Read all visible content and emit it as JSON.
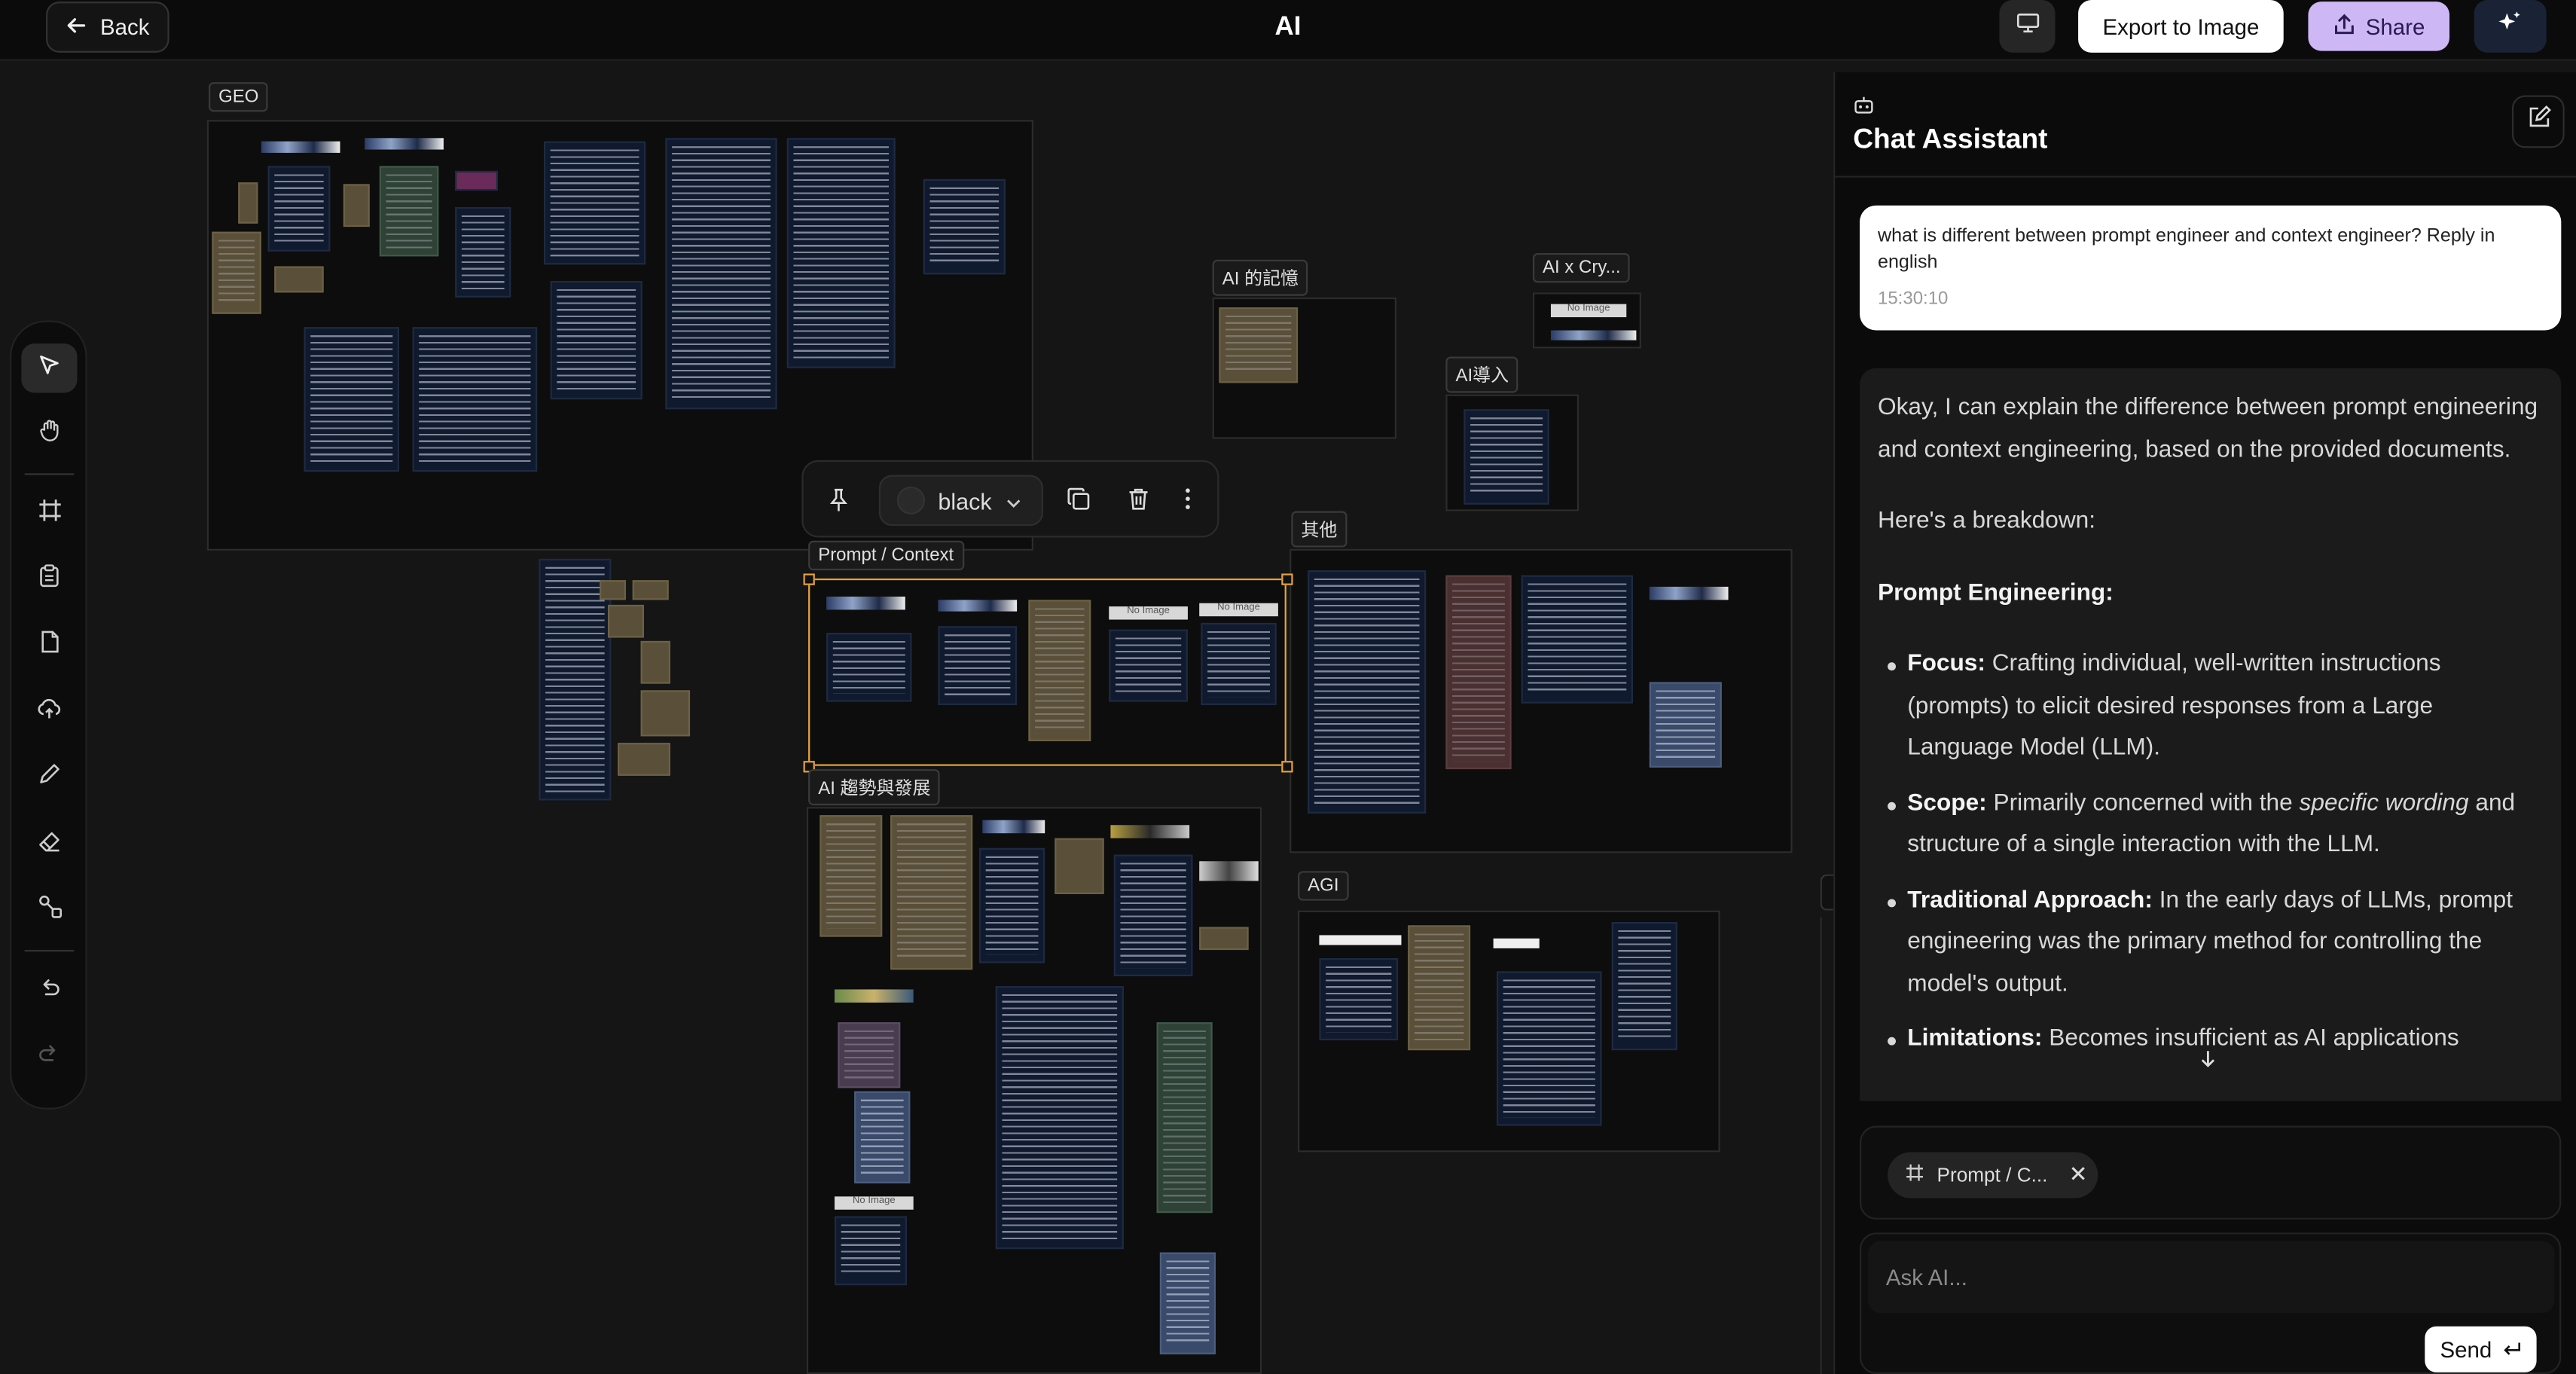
{
  "topbar": {
    "back_label": "Back",
    "title": "AI",
    "export_label": "Export to Image",
    "share_label": "Share"
  },
  "toolbar": {
    "tools": [
      "select-icon",
      "hand-icon",
      "frame-icon",
      "clipboard-icon",
      "file-icon",
      "cloud-upload-icon",
      "pencil-icon",
      "eraser-icon",
      "connector-icon",
      "undo-icon",
      "redo-icon"
    ]
  },
  "canvas": {
    "frames": {
      "geo": "GEO",
      "memory": "AI 的記憶",
      "crypto": "AI x Cry...",
      "adoption": "AI導入",
      "other": "其他",
      "prompt_context": "Prompt / Context",
      "trends": "AI 趨勢與發展",
      "agi": "AGI"
    },
    "no_image": "No Image"
  },
  "float_bar": {
    "color_value": "black"
  },
  "chat": {
    "title": "Chat Assistant",
    "user_message": "what is different between prompt engineer and context engineer? Reply in english",
    "user_time": "15:30:10",
    "ai_intro": "Okay, I can explain the difference between prompt engineering and context engineering, based on the provided documents.",
    "ai_breakdown": "Here's a breakdown:",
    "ai_heading": "Prompt Engineering:",
    "bullets": [
      {
        "term": "Focus:",
        "text": "Crafting individual, well-written instructions (prompts) to elicit desired responses from a Large Language Model (LLM)."
      },
      {
        "term": "Scope:",
        "text_pre": "Primarily concerned with the ",
        "text_em": "specific wording",
        "text_post": " and structure of a single interaction with the LLM."
      },
      {
        "term": "Traditional Approach:",
        "text": "In the early days of LLMs, prompt engineering was the primary method for controlling the model's output."
      },
      {
        "term": "Limitations:",
        "text": "Becomes insufficient as AI applications"
      }
    ],
    "context_chip": "Prompt / C...",
    "input_placeholder": "Ask AI...",
    "send_label": "Send"
  }
}
